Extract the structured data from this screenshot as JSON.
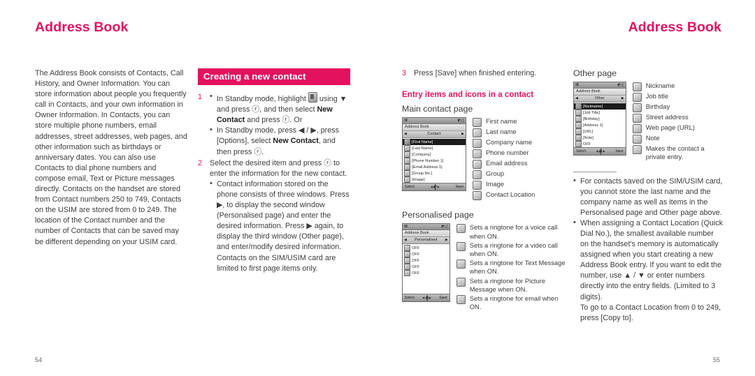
{
  "header": {
    "left_title": "Address Book",
    "right_title": "Address Book",
    "accent_color": "#e4115e"
  },
  "page_numbers": {
    "left": "54",
    "right": "55"
  },
  "col1": {
    "intro": "The Address Book consists of Contacts, Call History, and Owner Information. You can store information about people you frequently call in Contacts, and your own information in Owner Information. In Contacts, you can store multiple phone numbers, email addresses, street addresses, web pages, and other information such as birthdays or anniversary dates. You can also use Contacts to dial phone numbers and compose email, Text or Picture messages directly. Contacts on the handset are stored from Contact numbers 250 to 749, Contacts on the USIM are stored from 0 to 249. The location of the Contact number and the number of Contacts that can be saved may be different depending on your USIM card."
  },
  "col2": {
    "section_title": "Creating a new contact",
    "step1_number": "1",
    "step1_a_pre": "In Standby mode, highlight ",
    "step1_a_post": " using ▼ and press ⓡ, and then select ",
    "step1_a_bold": "New Contact",
    "step1_a_tail": " and press ⓡ. Or",
    "step1_b_pre": "In Standby mode, press ◀ / ▶, press [Options], select ",
    "step1_b_bold": "New Contact",
    "step1_b_tail": ", and then press ⓡ.",
    "step2_number": "2",
    "step2_text": "Select the desired item and press ⓡ to enter the information for the new contact.",
    "step2_bullet": "Contact information stored on the phone consists of three windows. Press ▶, to display the second window (Personalised page) and enter the desired information. Press ▶ again, to display the third window (Other page), and enter/modify desired information. Contacts on the SIM/USIM card are limited to first page items only."
  },
  "col3": {
    "step3_number": "3",
    "step3_text": "Press [Save] when finished entering.",
    "pink_heading": "Entry items and icons in a contact",
    "main_page_label": "Main contact page",
    "personalised_page_label": "Personalised page",
    "main_screen": {
      "status_left": "‖‖‖",
      "status_right": "◩ ◫",
      "title": "Address Book",
      "tab_left": "◀",
      "tab_center": "Contact",
      "tab_right": "▶",
      "rows": [
        {
          "icon": "contact-first-name-icon",
          "label": "[First Name]",
          "selected": true
        },
        {
          "icon": "contact-last-name-icon",
          "label": "[Last Name]",
          "selected": false
        },
        {
          "icon": "company-icon",
          "label": "[Company]",
          "selected": false
        },
        {
          "icon": "phone-number-icon",
          "label": "[Phone Number 1]",
          "selected": false
        },
        {
          "icon": "email-icon",
          "label": "[Email Address 1]",
          "selected": false
        },
        {
          "icon": "group-icon",
          "label": "[Group No.]",
          "selected": false
        },
        {
          "icon": "image-icon",
          "label": "[Image]",
          "selected": false
        }
      ],
      "soft_left": "Select",
      "soft_right": "Save"
    },
    "main_legend": [
      {
        "icon": "first-name-icon",
        "label": "First name"
      },
      {
        "icon": "last-name-icon",
        "label": "Last name"
      },
      {
        "icon": "company-name-icon",
        "label": "Company name"
      },
      {
        "icon": "phone-number-icon",
        "label": "Phone number"
      },
      {
        "icon": "email-address-icon",
        "label": "Email address"
      },
      {
        "icon": "group-icon",
        "label": "Group"
      },
      {
        "icon": "image-icon",
        "label": "Image"
      },
      {
        "icon": "contact-location-icon",
        "label": "Contact Location"
      }
    ],
    "personalised_screen": {
      "status_left": "‖‖‖",
      "status_right": "◩ ◫",
      "title": "Address Book",
      "tab_left": "◀",
      "tab_center": "Personalised",
      "tab_right": "▶",
      "rows": [
        {
          "icon": "voice-call-ringtone-icon",
          "label": "OFF",
          "selected": false
        },
        {
          "icon": "video-call-ringtone-icon",
          "label": "OFF",
          "selected": false
        },
        {
          "icon": "text-message-ringtone-icon",
          "label": "OFF",
          "selected": false
        },
        {
          "icon": "picture-message-ringtone-icon",
          "label": "OFF",
          "selected": false
        },
        {
          "icon": "email-ringtone-icon",
          "label": "OFF",
          "selected": false
        }
      ],
      "soft_left": "Select",
      "soft_right": "Save"
    },
    "personalised_legend": [
      {
        "icon": "voice-call-ringtone-icon",
        "label": "Sets a ringtone for a voice call when ON."
      },
      {
        "icon": "video-call-ringtone-icon",
        "label": "Sets a ringtone  for a video call when ON."
      },
      {
        "icon": "text-message-ringtone-icon",
        "label": "Sets a ringtone  for Text Message when ON."
      },
      {
        "icon": "picture-message-ringtone-icon",
        "label": "Sets a ringtone  for Picture Message when ON."
      },
      {
        "icon": "email-ringtone-icon",
        "label": "Sets a ringtone  for email when ON."
      }
    ]
  },
  "col4": {
    "other_page_label": "Other page",
    "other_screen": {
      "status_left": "‖‖‖",
      "status_right": "◩ ◫",
      "title": "Address Book",
      "tab_left": "◀",
      "tab_center": "Other",
      "tab_right": "▶",
      "rows": [
        {
          "icon": "nickname-icon",
          "label": "[Nickname]",
          "selected": true
        },
        {
          "icon": "job-title-icon",
          "label": "[Job Title]",
          "selected": false
        },
        {
          "icon": "birthday-icon",
          "label": "[Birthday]",
          "selected": false
        },
        {
          "icon": "street-address-icon",
          "label": "[Address 1]",
          "selected": false
        },
        {
          "icon": "url-icon",
          "label": "[URL]",
          "selected": false
        },
        {
          "icon": "note-icon",
          "label": "[Note]",
          "selected": false
        },
        {
          "icon": "private-key-icon",
          "label": "OFF",
          "selected": false
        }
      ],
      "soft_left": "Select",
      "soft_right": "Save"
    },
    "other_legend": [
      {
        "icon": "nickname-icon",
        "label": "Nickname"
      },
      {
        "icon": "job-title-icon",
        "label": "Job title"
      },
      {
        "icon": "birthday-icon",
        "label": "Birthday"
      },
      {
        "icon": "street-address-icon",
        "label": "Street address"
      },
      {
        "icon": "web-page-url-icon",
        "label": "Web page (URL)"
      },
      {
        "icon": "note-icon",
        "label": "Note"
      },
      {
        "icon": "private-key-icon",
        "label": "Makes the contact a private entry."
      }
    ],
    "notes": [
      "For contacts saved on the SIM/USIM card, you cannot store the last name and the company name as well as items in the Personalised page and Other page above.",
      "When assigning a Contact Location (Quick Dial No.), the smallest available number on the handset's memory is automatically assigned when you start creating a new Address Book entry. If you want to edit the number, use ▲ / ▼ or enter numbers directly into the entry fields. (Limited to 3 digits).",
      "To go to a Contact Location from 0 to 249, press [Copy to]."
    ]
  }
}
